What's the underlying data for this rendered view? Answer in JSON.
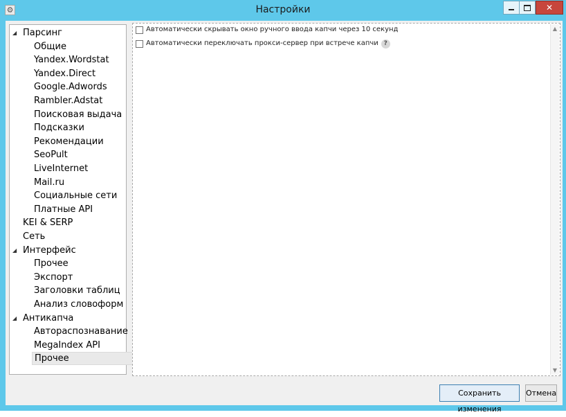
{
  "window": {
    "title": "Настройки"
  },
  "window_controls": {
    "minimize": "—",
    "maximize": "☐",
    "close": "✕"
  },
  "app_icon": "gear-icon",
  "sidebar": {
    "items": [
      {
        "label": "Парсинг",
        "level": 0,
        "expanded": true
      },
      {
        "label": "Общие",
        "level": 1
      },
      {
        "label": "Yandex.Wordstat",
        "level": 1
      },
      {
        "label": "Yandex.Direct",
        "level": 1
      },
      {
        "label": "Google.Adwords",
        "level": 1
      },
      {
        "label": "Rambler.Adstat",
        "level": 1
      },
      {
        "label": "Поисковая выдача",
        "level": 1
      },
      {
        "label": "Подсказки",
        "level": 1
      },
      {
        "label": "Рекомендации",
        "level": 1
      },
      {
        "label": "SeoPult",
        "level": 1
      },
      {
        "label": "LiveInternet",
        "level": 1
      },
      {
        "label": "Mail.ru",
        "level": 1
      },
      {
        "label": "Социальные сети",
        "level": 1
      },
      {
        "label": "Платные API",
        "level": 1
      },
      {
        "label": "KEI & SERP",
        "level": 0
      },
      {
        "label": "Сеть",
        "level": 0
      },
      {
        "label": "Интерфейс",
        "level": 0,
        "expanded": true
      },
      {
        "label": "Прочее",
        "level": 1
      },
      {
        "label": "Экспорт",
        "level": 1
      },
      {
        "label": "Заголовки таблиц",
        "level": 1
      },
      {
        "label": "Анализ словоформ",
        "level": 1
      },
      {
        "label": "Антикапча",
        "level": 0,
        "expanded": true
      },
      {
        "label": "Автораспознавание",
        "level": 1
      },
      {
        "label": "MegaIndex API",
        "level": 1
      },
      {
        "label": "Прочее",
        "level": 1,
        "selected": true
      }
    ]
  },
  "options": [
    {
      "label": "Автоматически скрывать окно ручного ввода капчи через 10 секунд",
      "checked": false,
      "help": false
    },
    {
      "label": "Автоматически переключать прокси-сервер при встрече капчи",
      "checked": false,
      "help": true
    }
  ],
  "help_icon_text": "?",
  "buttons": {
    "save_label": "Сохранить изменения",
    "cancel_label": "Отмена"
  },
  "colors": {
    "title_bar": "#5ec8ea",
    "close_button": "#c7463c",
    "selected_item": "#e9e9e9",
    "primary_button_border": "#3c7fb1"
  }
}
